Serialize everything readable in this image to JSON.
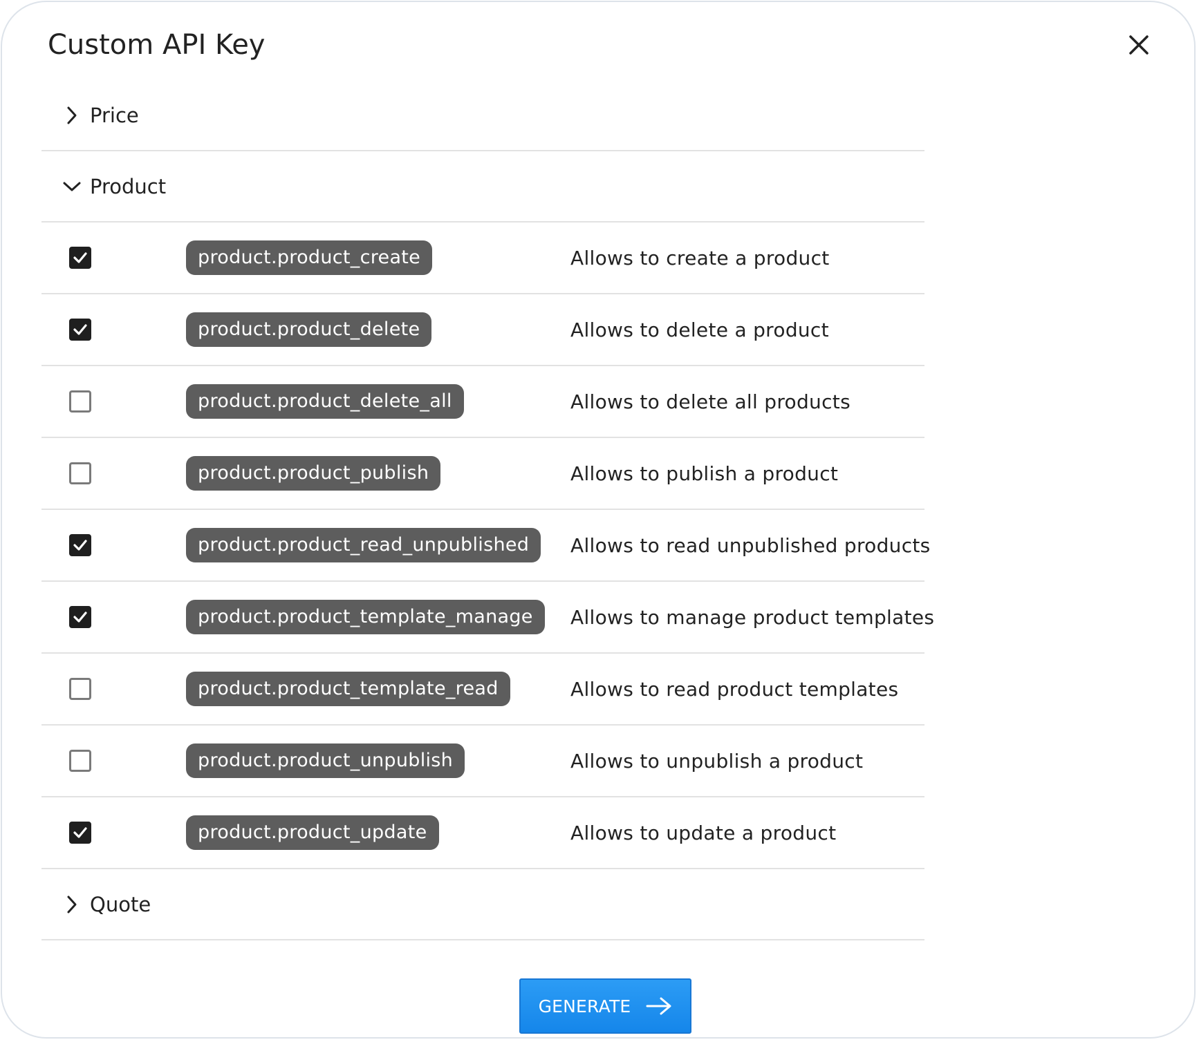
{
  "dialog": {
    "title": "Custom API Key",
    "close_icon": "close-icon"
  },
  "groups": [
    {
      "label": "Price",
      "expanded": false
    },
    {
      "label": "Product",
      "expanded": true
    },
    {
      "label": "Quote",
      "expanded": false
    }
  ],
  "permissions": [
    {
      "checked": true,
      "scope": "product.product_create",
      "description": "Allows to create a product"
    },
    {
      "checked": true,
      "scope": "product.product_delete",
      "description": "Allows to delete a product"
    },
    {
      "checked": false,
      "scope": "product.product_delete_all",
      "description": "Allows to delete all products"
    },
    {
      "checked": false,
      "scope": "product.product_publish",
      "description": "Allows to publish a product"
    },
    {
      "checked": true,
      "scope": "product.product_read_unpublished",
      "description": "Allows to read unpublished products"
    },
    {
      "checked": true,
      "scope": "product.product_template_manage",
      "description": "Allows to manage product templates"
    },
    {
      "checked": false,
      "scope": "product.product_template_read",
      "description": "Allows to read product templates"
    },
    {
      "checked": false,
      "scope": "product.product_unpublish",
      "description": "Allows to unpublish a product"
    },
    {
      "checked": true,
      "scope": "product.product_update",
      "description": "Allows to update a product"
    }
  ],
  "footer": {
    "generate_label": "GENERATE",
    "generate_icon": "arrow-right-icon"
  },
  "colors": {
    "primary_button": "#1586ea",
    "chip_background": "#5d5d5d",
    "checkbox_checked": "#1f1f1f"
  }
}
